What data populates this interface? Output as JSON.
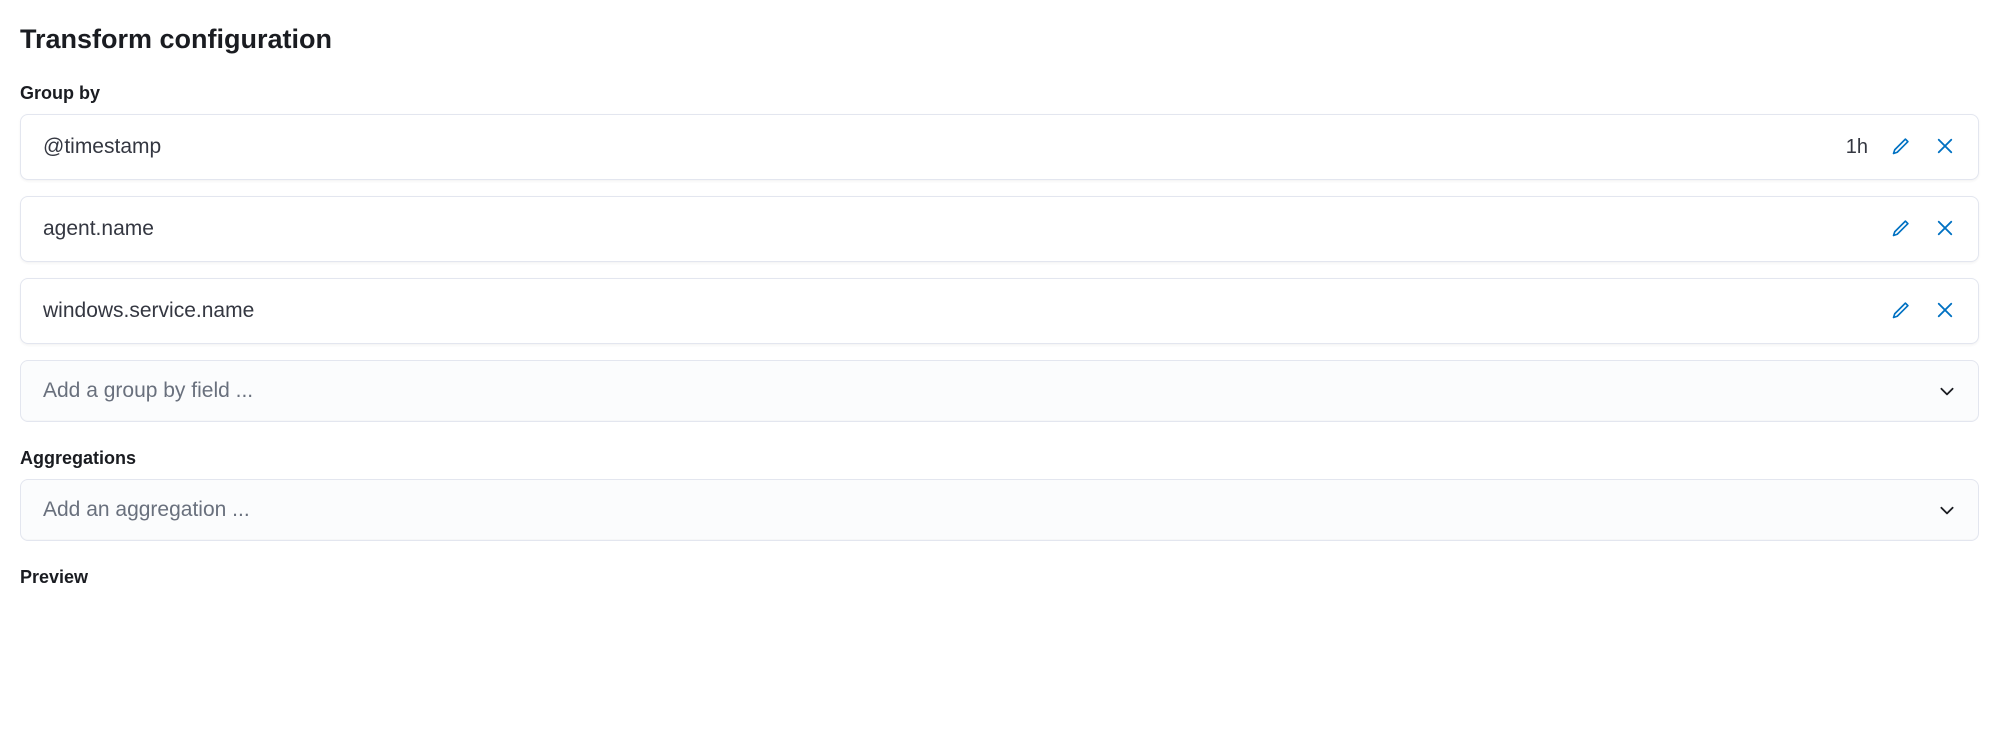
{
  "title": "Transform configuration",
  "groupBy": {
    "label": "Group by",
    "items": [
      {
        "field": "@timestamp",
        "badge": "1h"
      },
      {
        "field": "agent.name",
        "badge": null
      },
      {
        "field": "windows.service.name",
        "badge": null
      }
    ],
    "placeholder": "Add a group by field ..."
  },
  "aggregations": {
    "label": "Aggregations",
    "placeholder": "Add an aggregation ..."
  },
  "preview": {
    "label": "Preview"
  }
}
